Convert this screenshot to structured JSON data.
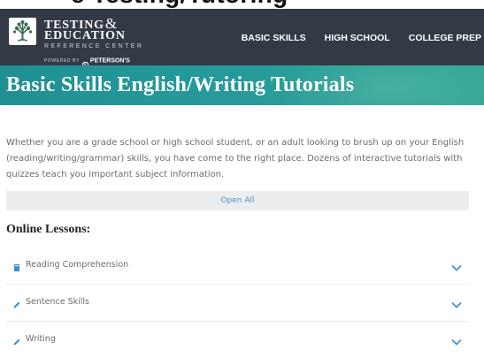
{
  "top_clip_text": "e Testing/Tutoring",
  "brand": {
    "line1": "TESTING",
    "amp": "&",
    "line2": "EDUCATION",
    "line3": "REFERENCE CENTER",
    "powered_by": "POWERED BY",
    "partner": "PETERSON'S",
    "logo_icon": "tree-icon",
    "partner_icon": "petersons-p-icon"
  },
  "nav": {
    "items": [
      {
        "label": "BASIC SKILLS"
      },
      {
        "label": "HIGH SCHOOL"
      },
      {
        "label": "COLLEGE PREP"
      }
    ]
  },
  "banner": {
    "title": "Basic Skills English/Writing Tutorials"
  },
  "intro": {
    "text": "Whether you are a grade school or high school student, or an adult looking to brush up on your English (reading/writing/grammar) skills, you have come to the right place. Dozens of interactive tutorials with quizzes teach you important subject information."
  },
  "open_all": {
    "label": "Open All"
  },
  "lessons": {
    "heading": "Online Lessons:",
    "items": [
      {
        "label": "Reading Comprehension",
        "icon": "book-icon"
      },
      {
        "label": "Sentence Skills",
        "icon": "pencil-icon"
      },
      {
        "label": "Writing",
        "icon": "pencil-icon"
      }
    ]
  },
  "colors": {
    "header_bg": "#323a46",
    "banner_teal": "#25999a",
    "accent_blue": "#4a90c8",
    "open_all_bg": "#ecedee"
  }
}
